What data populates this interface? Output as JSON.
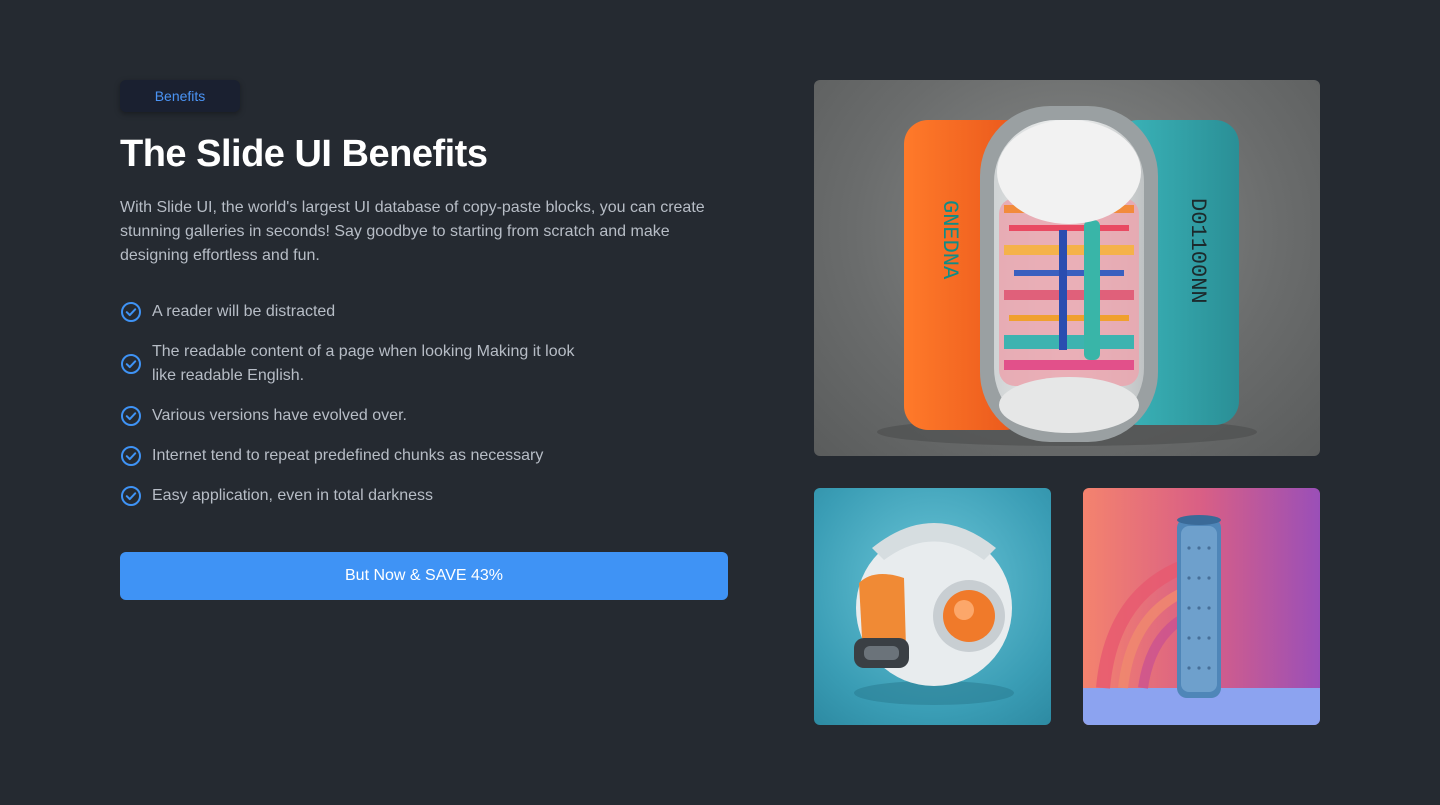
{
  "badge": "Benefits",
  "title": "The Slide UI Benefits",
  "description": "With Slide UI, the world's largest UI database of copy-paste blocks, you can create stunning galleries in seconds! Say goodbye to starting from scratch and make designing effortless and fun.",
  "benefits": [
    "A reader will be distracted",
    "The readable content of a page when looking Making it look like readable English.",
    "Various versions have evolved over.",
    "Internet tend to repeat predefined chunks as necessary",
    "Easy application, even in total darkness"
  ],
  "cta_label": "But Now & SAVE 43%",
  "colors": {
    "background": "#252a31",
    "accent": "#3f93f5",
    "text_muted": "#b7bdc6"
  },
  "icons": {
    "benefit": "check-circle-icon"
  }
}
